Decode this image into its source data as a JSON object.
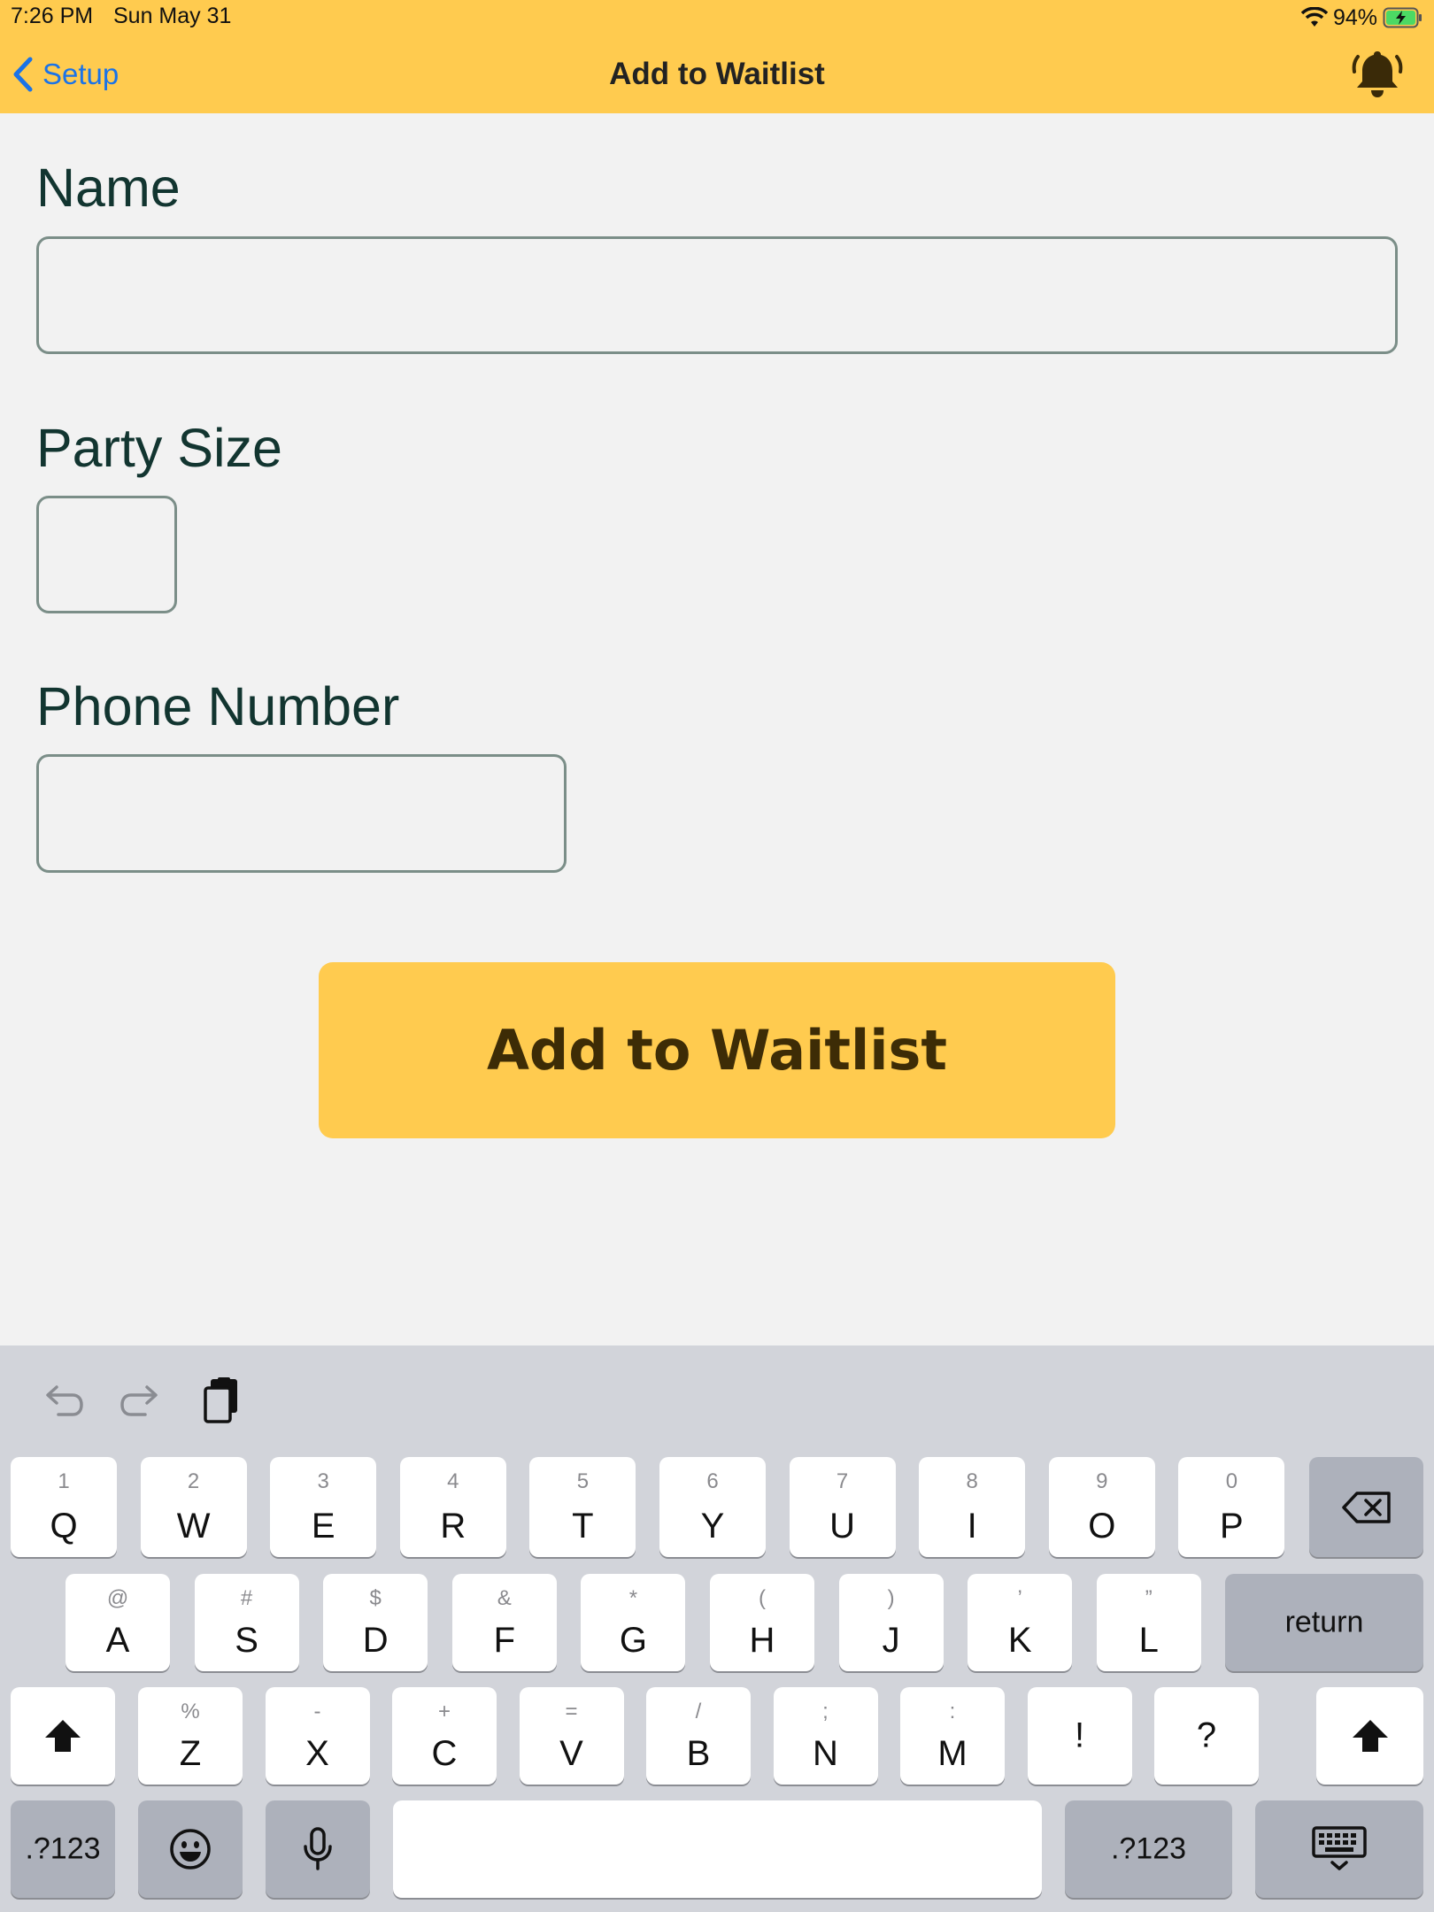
{
  "status_bar": {
    "time": "7:26 PM",
    "date": "Sun May 31",
    "battery": "94%"
  },
  "nav": {
    "back_label": "Setup",
    "title": "Add to Waitlist",
    "bell_icon": "bell-ringing-icon"
  },
  "form": {
    "name_label": "Name",
    "name_value": "",
    "party_size_label": "Party Size",
    "party_size_value": "",
    "phone_label": "Phone Number",
    "phone_value": "",
    "submit_label": "Add to Waitlist"
  },
  "keyboard": {
    "row1": [
      {
        "alt": "1",
        "key": "Q"
      },
      {
        "alt": "2",
        "key": "W"
      },
      {
        "alt": "3",
        "key": "E"
      },
      {
        "alt": "4",
        "key": "R"
      },
      {
        "alt": "5",
        "key": "T"
      },
      {
        "alt": "6",
        "key": "Y"
      },
      {
        "alt": "7",
        "key": "U"
      },
      {
        "alt": "8",
        "key": "I"
      },
      {
        "alt": "9",
        "key": "O"
      },
      {
        "alt": "0",
        "key": "P"
      }
    ],
    "row2": [
      {
        "alt": "@",
        "key": "A"
      },
      {
        "alt": "#",
        "key": "S"
      },
      {
        "alt": "$",
        "key": "D"
      },
      {
        "alt": "&",
        "key": "F"
      },
      {
        "alt": "*",
        "key": "G"
      },
      {
        "alt": "(",
        "key": "H"
      },
      {
        "alt": ")",
        "key": "J"
      },
      {
        "alt": "’",
        "key": "K"
      },
      {
        "alt": "”",
        "key": "L"
      }
    ],
    "row3": [
      {
        "alt": "%",
        "key": "Z"
      },
      {
        "alt": "-",
        "key": "X"
      },
      {
        "alt": "+",
        "key": "C"
      },
      {
        "alt": "=",
        "key": "V"
      },
      {
        "alt": "/",
        "key": "B"
      },
      {
        "alt": ";",
        "key": "N"
      },
      {
        "alt": ":",
        "key": "M"
      },
      {
        "alt": "",
        "key": "!"
      },
      {
        "alt": "",
        "key": "?"
      }
    ],
    "return_label": "return",
    "numbers_label": ".?123",
    "icons": {
      "undo": "undo-icon",
      "redo": "redo-icon",
      "paste": "paste-icon",
      "delete": "backspace-icon",
      "shift": "shift-icon",
      "emoji": "emoji-icon",
      "mic": "microphone-icon",
      "dismiss": "keyboard-dismiss-icon"
    }
  },
  "colors": {
    "accent": "#ffcb4f",
    "link": "#1a73e8",
    "label_text": "#123530",
    "button_text": "#3d2c06"
  }
}
